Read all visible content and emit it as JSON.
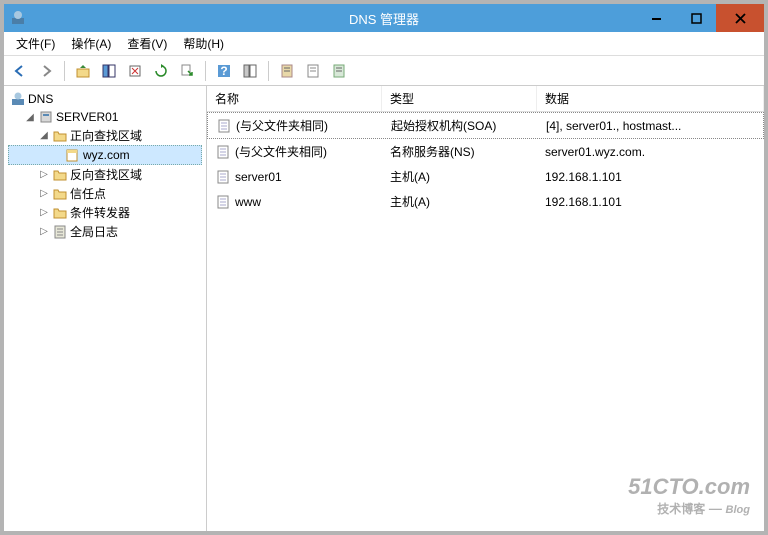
{
  "titlebar": {
    "title": "DNS 管理器"
  },
  "menu": {
    "file": "文件(F)",
    "action": "操作(A)",
    "view": "查看(V)",
    "help": "帮助(H)"
  },
  "tree": {
    "root": "DNS",
    "server": "SERVER01",
    "forward": "正向查找区域",
    "zone": "wyz.com",
    "reverse": "反向查找区域",
    "trust": "信任点",
    "conditional": "条件转发器",
    "global_log": "全局日志"
  },
  "list": {
    "headers": {
      "name": "名称",
      "type": "类型",
      "data": "数据"
    },
    "rows": [
      {
        "name": "(与父文件夹相同)",
        "type": "起始授权机构(SOA)",
        "data": "[4], server01., hostmast..."
      },
      {
        "name": "(与父文件夹相同)",
        "type": "名称服务器(NS)",
        "data": "server01.wyz.com."
      },
      {
        "name": "server01",
        "type": "主机(A)",
        "data": "192.168.1.101"
      },
      {
        "name": "www",
        "type": "主机(A)",
        "data": "192.168.1.101"
      }
    ]
  },
  "watermark": {
    "main": "51CTO.com",
    "sub": "技术博客",
    "tag": "Blog"
  }
}
